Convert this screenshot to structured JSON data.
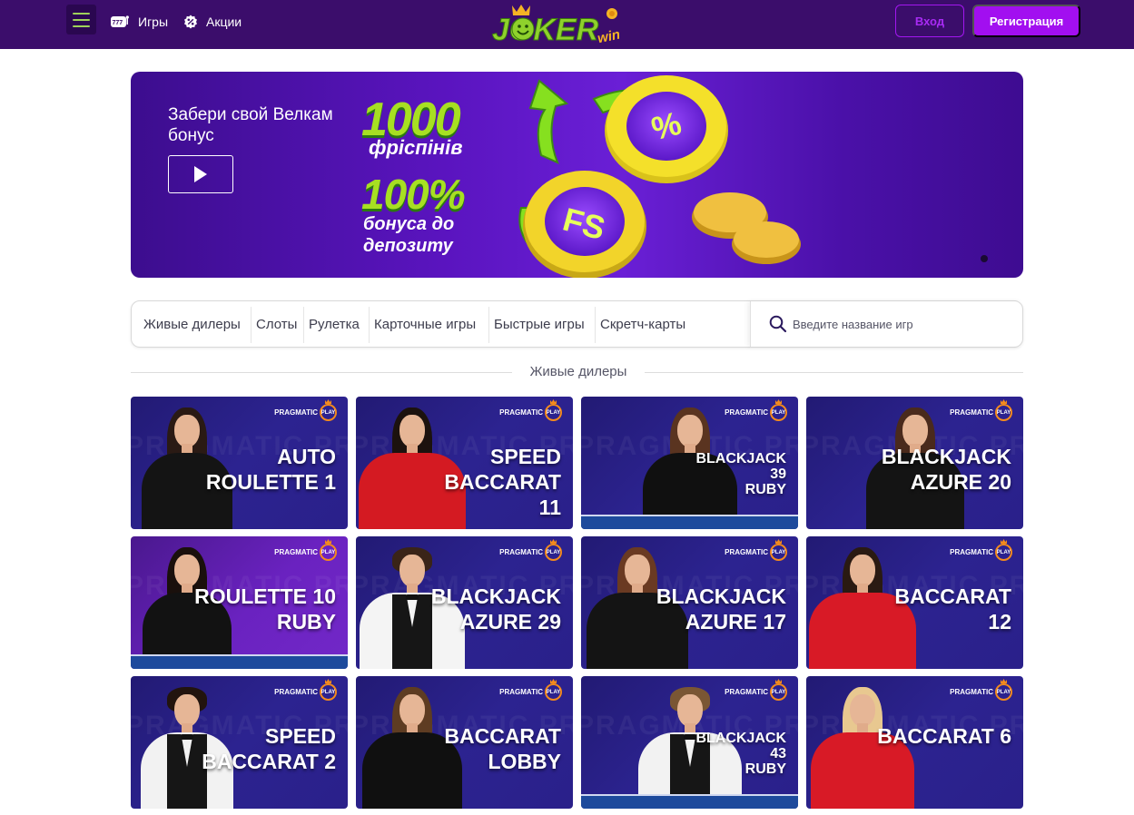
{
  "header": {
    "nav": [
      {
        "label": "Игры",
        "icon": "slot-777-icon"
      },
      {
        "label": "Акции",
        "icon": "percent-badge-icon"
      }
    ],
    "logo": {
      "text": "JOKER",
      "suffix": "win"
    },
    "login_label": "Вход",
    "register_label": "Регистрация"
  },
  "banner": {
    "text": "Забери свой Велкам бонус",
    "promo_line1": "1000",
    "promo_line2": "фріспінів",
    "promo_line3": "100%",
    "promo_line4": "бонуса до депозиту",
    "chip_label_1": "%",
    "chip_label_2": "FS"
  },
  "categories": [
    "Живые дилеры",
    "Слоты",
    "Рулетка",
    "Карточные игры",
    "Быстрые игры",
    "Скретч-карты"
  ],
  "search": {
    "placeholder": "Введите название игр"
  },
  "section": {
    "title": "Живые дилеры"
  },
  "provider": {
    "name": "PRAGMATIC",
    "suffix": "PLAY"
  },
  "games": [
    {
      "title": "AUTO\nROULETTE 1",
      "size": "lg"
    },
    {
      "title": "SPEED\nBACCARAT\n11",
      "size": "lg"
    },
    {
      "title": "BLACKJACK\n39\nRUBY",
      "size": "sm"
    },
    {
      "title": "BLACKJACK\nAZURE 20",
      "size": "lg"
    },
    {
      "title": "ROULETTE 10\nRUBY",
      "size": "lg"
    },
    {
      "title": "BLACKJACK\nAZURE 29",
      "size": "lg"
    },
    {
      "title": "BLACKJACK\nAZURE 17",
      "size": "lg"
    },
    {
      "title": "BACCARAT\n12",
      "size": "lg"
    },
    {
      "title": "SPEED\nBACCARAT 2",
      "size": "lg"
    },
    {
      "title": "BACCARAT\nLOBBY",
      "size": "lg"
    },
    {
      "title": "BLACKJACK\n43\nRUBY",
      "size": "sm"
    },
    {
      "title": "BACCARAT 6",
      "size": "lg"
    }
  ],
  "colors": {
    "header_bg": "#3b0d6b",
    "accent": "#a20ff0",
    "promo_green": "#a7e022"
  }
}
